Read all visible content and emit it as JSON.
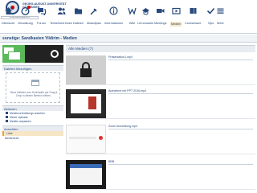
{
  "header": {
    "university_name": "GEORG-AUGUST-UNIVERSITÄT\nGÖTTINGEN",
    "breadcrumb_label": "Veranstaltungsansicht",
    "nav": [
      {
        "label": "Übersicht",
        "icon": "home-icon",
        "badge": true
      },
      {
        "label": "Verwaltung",
        "icon": "gauge-icon",
        "badge": true
      },
      {
        "label": "Forum",
        "icon": "forum-icon",
        "badge": false
      },
      {
        "label": "TeilnehmerInnen",
        "icon": "people-icon",
        "badge": false
      },
      {
        "label": "Dateien",
        "icon": "folder-icon",
        "badge": false
      },
      {
        "label": "Ablaufplan",
        "icon": "calendar-icon",
        "badge": false
      },
      {
        "label": "Informationen",
        "icon": "info-icon",
        "badge": false
      },
      {
        "label": "Wiki",
        "icon": "wiki-icon",
        "badge": false
      },
      {
        "label": "Lernmodule",
        "icon": "modules-icon",
        "badge": false
      },
      {
        "label": "Meetings",
        "icon": "meetings-icon",
        "badge": false
      },
      {
        "label": "Medien",
        "icon": "media-icon",
        "badge": false,
        "active": true
      },
      {
        "label": "Courseware",
        "icon": "courseware-icon",
        "badge": false
      },
      {
        "label": "Vips",
        "icon": "vips-icon",
        "badge": false
      },
      {
        "label": "Mehr",
        "icon": "more-icon",
        "badge": false
      }
    ]
  },
  "page_title": "sonstige: Sandkasten Yildirim - Medien",
  "sidebar": {
    "upload_heading": "Dateien hinzufügen",
    "dropzone_text": "Neue Dateien zum Hochladen per Drag & Drop in diesen Bereich ziehen.",
    "actions_heading": "Aktionen",
    "actions": [
      "Medienverbreitungs ansehen",
      "Meine Uploads",
      "Medien anpassen"
    ],
    "views_heading": "Ansichten",
    "views": [
      {
        "label": "Liste",
        "active": true
      },
      {
        "label": "Medienzeil",
        "active": false
      }
    ]
  },
  "main": {
    "header": "Alle Medien (7)",
    "items": [
      {
        "title": "Präsentation1.mp4"
      },
      {
        "title": "Aufnahme mit PPT 2016.mp4"
      },
      {
        "title": "Zoom Anmeldung.mp4"
      },
      {
        "title": "BBB"
      }
    ]
  },
  "colors": {
    "brand": "#28497c",
    "active_tab": "#f6e6c6",
    "badge": "#d60000"
  }
}
